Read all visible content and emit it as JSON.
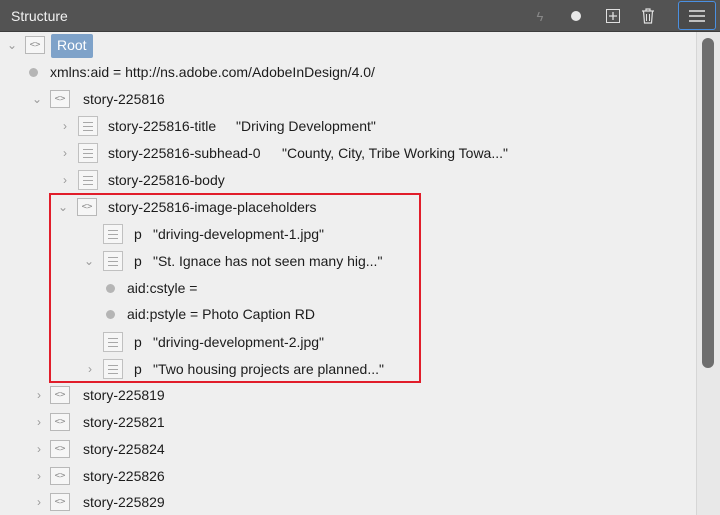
{
  "panel": {
    "title": "Structure"
  },
  "toolbar": {
    "icons": [
      "lightning-icon",
      "dot-icon",
      "add-icon",
      "trash-icon",
      "menu-icon"
    ]
  },
  "tree": {
    "root": "Root",
    "xmlns": "xmlns:aid = http://ns.adobe.com/AdobeInDesign/4.0/",
    "story1": "story-225816",
    "title_row": {
      "name": "story-225816-title",
      "value": "\"Driving Development\""
    },
    "subhead_row": {
      "name": "story-225816-subhead-0",
      "value": "\"County, City, Tribe Working Towa...\""
    },
    "body_row": "story-225816-body",
    "images_row": "story-225816-image-placeholders",
    "p1": {
      "tag": "p",
      "value": "\"driving-development-1.jpg\""
    },
    "p2": {
      "tag": "p",
      "value": "\"St. Ignace has not seen many hig...\""
    },
    "attr_cstyle": "aid:cstyle =",
    "attr_pstyle": "aid:pstyle = Photo Caption RD",
    "p3": {
      "tag": "p",
      "value": "\"driving-development-2.jpg\""
    },
    "p4": {
      "tag": "p",
      "value": "\"Two housing projects are planned...\""
    },
    "stories": [
      "story-225819",
      "story-225821",
      "story-225824",
      "story-225826",
      "story-225829"
    ]
  },
  "colors": {
    "highlight": "#e11d2a",
    "selection": "#7ea2c9",
    "header": "#535353"
  }
}
